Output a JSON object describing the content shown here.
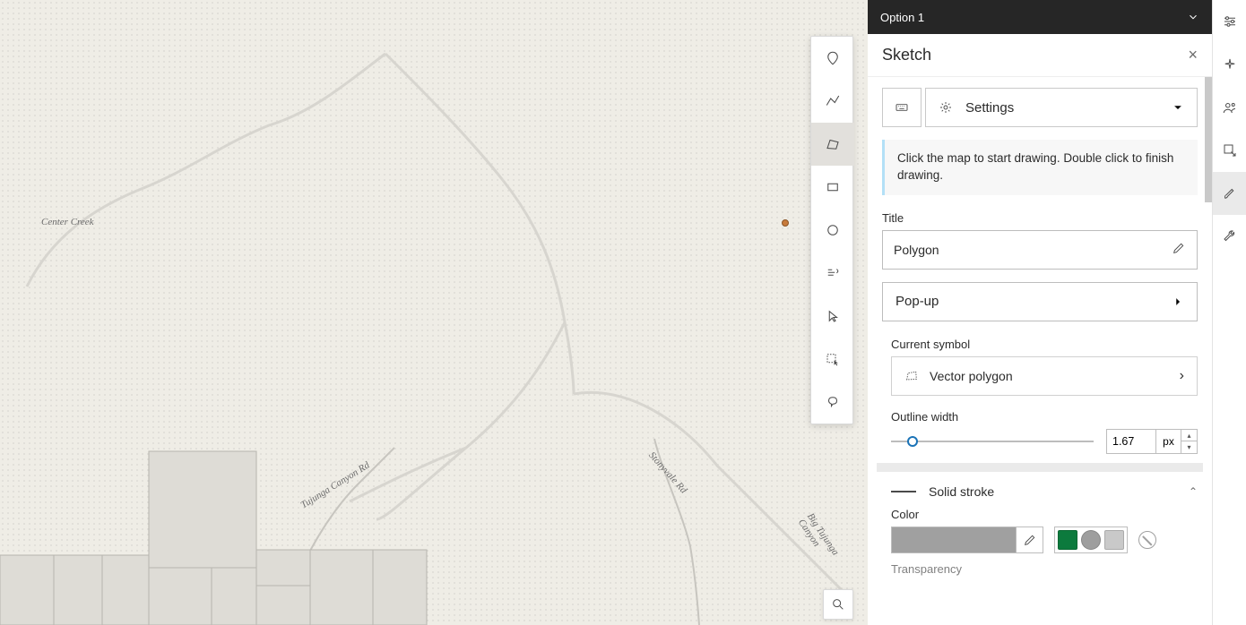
{
  "option_bar": {
    "label": "Option 1"
  },
  "panel": {
    "title": "Sketch",
    "settings_label": "Settings",
    "info": "Click the map to start drawing. Double click to finish drawing.",
    "title_section": {
      "label": "Title",
      "value": "Polygon"
    },
    "popup_label": "Pop-up",
    "symbol_section": {
      "label": "Current symbol",
      "value": "Vector polygon"
    },
    "outline": {
      "label": "Outline width",
      "value": "1.67",
      "unit": "px",
      "slider_pct": 8
    },
    "stroke": {
      "label": "Solid stroke"
    },
    "color_section": {
      "label": "Color",
      "current": "#a0a0a0",
      "swatches": [
        "#0c7a3d",
        "#9e9e9e",
        "#c9c9c9"
      ]
    },
    "transparency_label": "Transparency"
  },
  "map": {
    "labels": {
      "center_creek": "Center Creek",
      "tujunga": "Tujunga Canyon Rd",
      "stonyvale": "Stonyvale Rd",
      "big_tujunga": "Big Tujunga Canyon"
    }
  }
}
